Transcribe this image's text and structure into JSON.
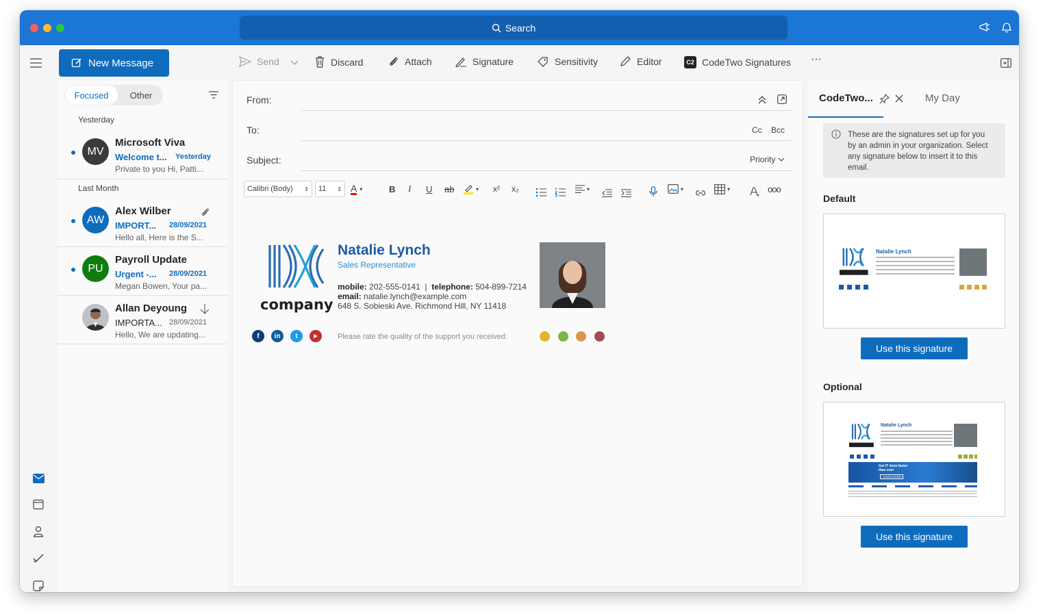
{
  "app": {
    "search_placeholder": "Search",
    "colors": {
      "titlebar": "#1b76d6",
      "accent": "#0f6cbd"
    }
  },
  "toolbar": {
    "new_message": "New Message",
    "send": "Send",
    "discard": "Discard",
    "attach": "Attach",
    "signature": "Signature",
    "sensitivity": "Sensitivity",
    "editor": "Editor",
    "codetwo": "CodeTwo Signatures",
    "more": "···"
  },
  "maillist": {
    "tabs": {
      "focused": "Focused",
      "other": "Other"
    },
    "groups": {
      "yesterday": "Yesterday",
      "last_month": "Last Month"
    },
    "messages": [
      {
        "initials": "MV",
        "sender": "Microsoft Viva",
        "subject": "Welcome t...",
        "date": "Yesterday",
        "preview": "Private to you Hi, Patti...",
        "unread": true,
        "avatar_color": "#3b3b3b"
      },
      {
        "initials": "AW",
        "sender": "Alex Wilber",
        "subject": "IMPORT...",
        "date": "28/09/2021",
        "preview": "Hello all, Here is the S...",
        "unread": true,
        "avatar_color": "#0f6cbd"
      },
      {
        "initials": "PU",
        "sender": "Payroll Update",
        "subject": "Urgent -...",
        "date": "28/09/2021",
        "preview": "Megan Bowen, Your pa...",
        "unread": true,
        "avatar_color": "#107c10"
      },
      {
        "initials": "",
        "sender": "Allan Deyoung",
        "subject": "IMPORTA...",
        "date": "28/09/2021",
        "preview": "Hello, We are updating...",
        "unread": false,
        "avatar_color": "#6b6b6b"
      }
    ]
  },
  "compose": {
    "from_label": "From:",
    "to_label": "To:",
    "cc": "Cc",
    "bcc": "Bcc",
    "subject_label": "Subject:",
    "priority": "Priority",
    "font": "Calibri (Body)",
    "font_size": "11"
  },
  "signature": {
    "company": "company",
    "name": "Natalie Lynch",
    "title": "Sales Representative",
    "mobile_label": "mobile:",
    "mobile": "202-555-0141",
    "telephone_label": "telephone:",
    "telephone": "504-899-7214",
    "email_label": "email:",
    "email": "natalie.lynch@example.com",
    "address": "648 S. Sobieski Ave. Richmond Hill, NY 11418",
    "rate_prompt": "Please rate the quality of the support you received:"
  },
  "sidepane": {
    "tab_active": "CodeTwo...",
    "tab_other": "My Day",
    "info": "These are the signatures set up for you by an admin in your organization. Select any signature below to insert it to this email.",
    "default_label": "Default",
    "optional_label": "Optional",
    "use_button": "Use this signature",
    "banner_text": "Get IT done faster than ever",
    "banner_cta": "LEARN MORE"
  }
}
